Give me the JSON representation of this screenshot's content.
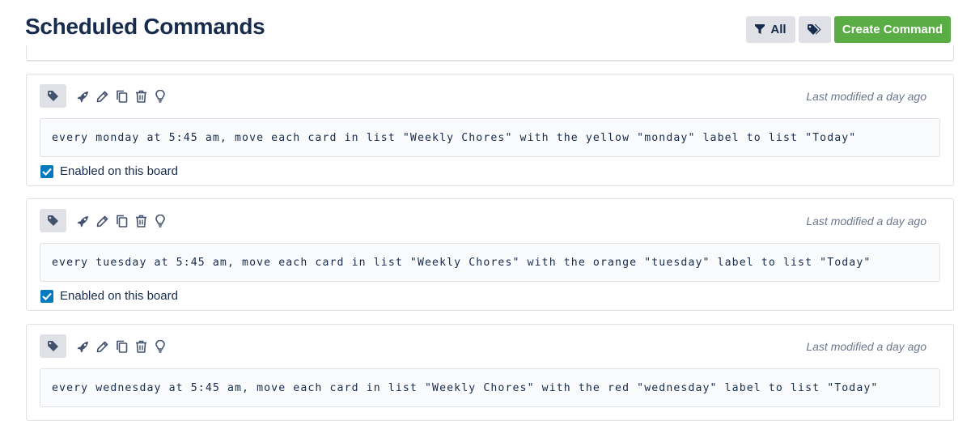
{
  "header": {
    "title": "Scheduled Commands",
    "filter_label": "All",
    "filter_icon": "filter-icon",
    "tags_icon": "tags-icon",
    "create_label": "Create Command",
    "create_color": "#5aac44"
  },
  "commands": [
    {
      "text": "every monday at 5:45 am, move each card in list \"Weekly Chores\" with the yellow \"monday\" label to list \"Today\"",
      "modified": "Last modified a day ago",
      "enabled": true,
      "enabled_label": "Enabled on this board"
    },
    {
      "text": "every tuesday at 5:45 am, move each card in list \"Weekly Chores\" with the orange \"tuesday\" label to list \"Today\"",
      "modified": "Last modified a day ago",
      "enabled": true,
      "enabled_label": "Enabled on this board"
    },
    {
      "text": "every wednesday at 5:45 am, move each card in list \"Weekly Chores\" with the red \"wednesday\" label to list \"Today\"",
      "modified": "Last modified a day ago"
    }
  ],
  "toolbar_icons": [
    "tag-icon",
    "rocket-icon",
    "pencil-icon",
    "copy-icon",
    "trash-icon",
    "lightbulb-icon"
  ],
  "colors": {
    "title": "#172b4d",
    "checkbox": "#0079bf",
    "muted": "#6b778c"
  }
}
